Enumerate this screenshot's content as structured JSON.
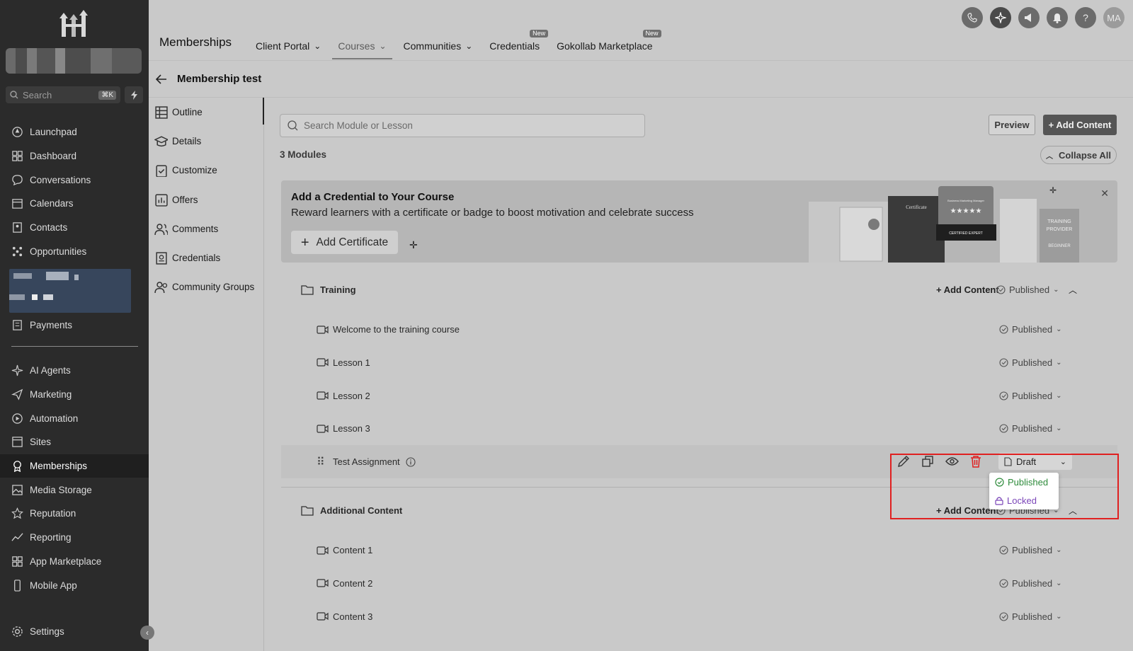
{
  "sidebar": {
    "search_placeholder": "Search",
    "search_shortcut": "⌘K",
    "items": [
      {
        "label": "Launchpad",
        "icon": "rocket-icon"
      },
      {
        "label": "Dashboard",
        "icon": "grid-icon"
      },
      {
        "label": "Conversations",
        "icon": "chat-icon"
      },
      {
        "label": "Calendars",
        "icon": "calendar-icon"
      },
      {
        "label": "Contacts",
        "icon": "contacts-icon"
      },
      {
        "label": "Opportunities",
        "icon": "opportunities-icon"
      }
    ],
    "items_after_blur": [
      {
        "label": "Payments",
        "icon": "payments-icon"
      }
    ],
    "items_lower": [
      {
        "label": "AI Agents",
        "icon": "sparkle-icon"
      },
      {
        "label": "Marketing",
        "icon": "send-icon"
      },
      {
        "label": "Automation",
        "icon": "automation-icon"
      },
      {
        "label": "Sites",
        "icon": "sites-icon"
      },
      {
        "label": "Memberships",
        "icon": "memberships-icon",
        "active": true
      },
      {
        "label": "Media Storage",
        "icon": "image-icon"
      },
      {
        "label": "Reputation",
        "icon": "star-icon"
      },
      {
        "label": "Reporting",
        "icon": "chart-line-icon"
      },
      {
        "label": "App Marketplace",
        "icon": "apps-icon"
      },
      {
        "label": "Mobile App",
        "icon": "mobile-icon"
      }
    ],
    "settings_label": "Settings"
  },
  "topbar": {
    "app_title": "Memberships",
    "tabs": [
      {
        "label": "Client Portal",
        "dropdown": true
      },
      {
        "label": "Courses",
        "dropdown": true,
        "active": true
      },
      {
        "label": "Communities",
        "dropdown": true
      },
      {
        "label": "Credentials",
        "badge": "New"
      },
      {
        "label": "Gokollab Marketplace",
        "badge": "New"
      }
    ],
    "avatar_initials": "MA"
  },
  "page": {
    "title": "Membership test"
  },
  "subnav": [
    {
      "label": "Outline",
      "icon": "outline-icon"
    },
    {
      "label": "Details",
      "icon": "graduation-cap-icon"
    },
    {
      "label": "Customize",
      "icon": "clipboard-check-icon"
    },
    {
      "label": "Offers",
      "icon": "offers-chart-icon"
    },
    {
      "label": "Comments",
      "icon": "users-icon"
    },
    {
      "label": "Credentials",
      "icon": "credential-icon"
    },
    {
      "label": "Community Groups",
      "icon": "community-icon"
    }
  ],
  "main": {
    "search_placeholder": "Search Module or Lesson",
    "preview_label": "Preview",
    "add_content_label": "+ Add Content",
    "modules_count": "3 Modules",
    "collapse_all_label": "Collapse All",
    "banner": {
      "title": "Add a Credential to Your Course",
      "subtitle": "Reward learners with a certificate or badge to boost motivation and celebrate success",
      "button": "Add Certificate",
      "art_certificate": "Certificate",
      "art_badge": "CERTIFIED EXPERT",
      "art_provider": "TRAINING PROVIDER",
      "art_level": "BEGINNER",
      "art_manager": "Business Marketing Manager"
    },
    "modules": [
      {
        "title": "Training",
        "add_label": "+ Add Content",
        "status": "Published",
        "lessons": [
          {
            "title": "Welcome to the training course",
            "status": "Published"
          },
          {
            "title": "Lesson 1",
            "status": "Published"
          },
          {
            "title": "Lesson 2",
            "status": "Published"
          },
          {
            "title": "Lesson 3",
            "status": "Published"
          },
          {
            "title": "Test Assignment",
            "status": "Draft"
          }
        ]
      },
      {
        "title": "Additional Content",
        "add_label": "+ Add Content",
        "status": "Published",
        "lessons": [
          {
            "title": "Content 1",
            "status": "Published"
          },
          {
            "title": "Content 2",
            "status": "Published"
          },
          {
            "title": "Content 3",
            "status": "Published"
          }
        ]
      }
    ],
    "status_dropdown": {
      "current": "Draft",
      "options": [
        "Published",
        "Locked"
      ]
    }
  },
  "colors": {
    "sidebar_bg": "#2b2b2b",
    "page_bg": "#c9c9c9",
    "highlight_red": "#e02020",
    "published_green": "#2e8b3b",
    "locked_purple": "#7a45b8"
  }
}
